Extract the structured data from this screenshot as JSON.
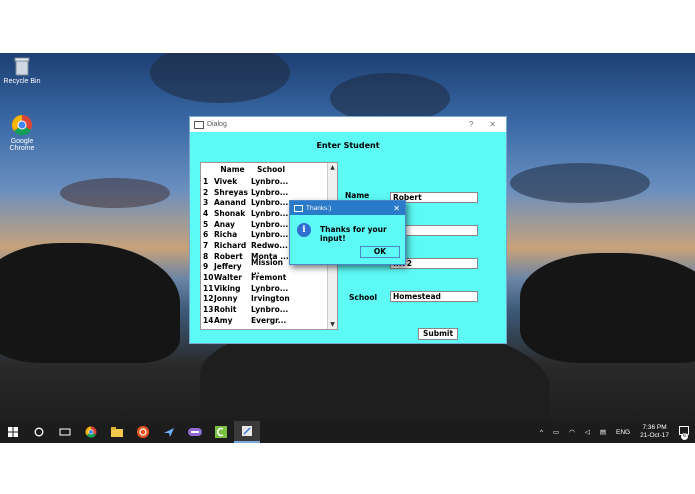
{
  "desktop": {
    "icons": [
      {
        "label": "Recycle Bin",
        "icon": "recycle-bin-icon"
      },
      {
        "label": "Google Chrome",
        "icon": "chrome-icon"
      }
    ]
  },
  "dialog": {
    "title": "Dialog",
    "help_glyph": "?",
    "close_glyph": "✕",
    "header": "Enter Student",
    "list": {
      "columns": [
        "Name",
        "School"
      ],
      "rows": [
        {
          "num": "1",
          "name": "Vivek",
          "school": "Lynbro..."
        },
        {
          "num": "2",
          "name": "Shreyas",
          "school": "Lynbro..."
        },
        {
          "num": "3",
          "name": "Aanand",
          "school": "Lynbro..."
        },
        {
          "num": "4",
          "name": "Shonak",
          "school": "Lynbro..."
        },
        {
          "num": "5",
          "name": "Anay",
          "school": "Lynbro..."
        },
        {
          "num": "6",
          "name": "Richa",
          "school": "Lynbro..."
        },
        {
          "num": "7",
          "name": "Richard",
          "school": "Redwo..."
        },
        {
          "num": "8",
          "name": "Robert",
          "school": "Monta ..."
        },
        {
          "num": "9",
          "name": "Jeffery",
          "school": "Mission ..."
        },
        {
          "num": "10",
          "name": "Walter",
          "school": "Fremont"
        },
        {
          "num": "11",
          "name": "Viking",
          "school": "Lynbro..."
        },
        {
          "num": "12",
          "name": "Jonny",
          "school": "Irvington"
        },
        {
          "num": "13",
          "name": "Rohit",
          "school": "Lynbro..."
        },
        {
          "num": "14",
          "name": "Amy",
          "school": "Evergr..."
        }
      ]
    },
    "form": {
      "name_label": "Name",
      "name_value": "Robert",
      "field2_value": "",
      "field3_value": "...72",
      "school_label": "School",
      "school_value": "Homestead"
    },
    "submit_label": "Submit"
  },
  "message_box": {
    "title": "Thanks:)",
    "close_glyph": "✕",
    "text": "Thanks for your input!",
    "ok_label": "OK"
  },
  "taskbar": {
    "apps": [
      "start-icon",
      "search-icon",
      "task-view-icon",
      "chrome-icon",
      "file-explorer-icon",
      "ubuntu-icon",
      "plane-app-icon",
      "media-app-icon",
      "green-app-icon",
      "editor-app-icon"
    ],
    "tray": {
      "language": "ENG",
      "time": "7:36 PM",
      "date": "21-Oct-17",
      "notification_count": "6"
    }
  }
}
